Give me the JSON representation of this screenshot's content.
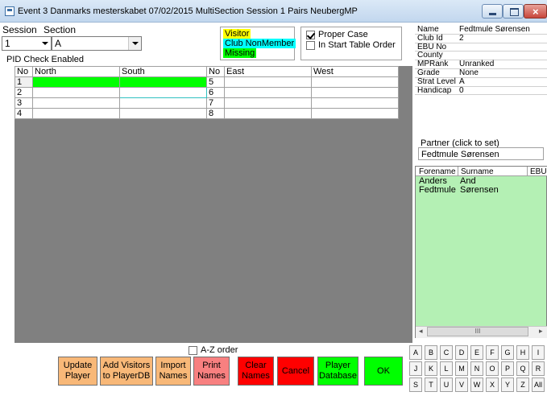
{
  "window": {
    "title": "Event 3   Danmarks mesterskabet 07/02/2015 MultiSection Session 1 Pairs NeubergMP"
  },
  "session": {
    "label": "Session",
    "value": "1"
  },
  "section": {
    "label": "Section",
    "value": "A"
  },
  "pid_status": "PID Check Enabled",
  "legend": {
    "visitor": "Visitor",
    "club_nonmember": "Club NonMember",
    "missing": "Missing"
  },
  "options": {
    "proper_case": "Proper Case",
    "start_table_order": "In Start Table Order"
  },
  "grid": {
    "left_headers": [
      "No",
      "North",
      "South"
    ],
    "right_headers": [
      "No",
      "East",
      "West"
    ],
    "left_numbers": [
      "1",
      "2",
      "3",
      "4"
    ],
    "right_numbers": [
      "5",
      "6",
      "7",
      "8"
    ]
  },
  "info": [
    {
      "key": "Name",
      "value": "Fedtmule Sørensen"
    },
    {
      "key": "Club Id",
      "value": "2"
    },
    {
      "key": "EBU No",
      "value": ""
    },
    {
      "key": "County",
      "value": ""
    },
    {
      "key": "MPRank",
      "value": "Unranked"
    },
    {
      "key": "Grade",
      "value": "None"
    },
    {
      "key": "Strat Level",
      "value": "A"
    },
    {
      "key": "Handicap",
      "value": "0"
    }
  ],
  "partner": {
    "label": "Partner (click to set)",
    "value": "Fedtmule Sørensen"
  },
  "players": {
    "headers": [
      "Forename",
      "Surname",
      "EBU"
    ],
    "rows": [
      {
        "forename": "Anders",
        "surname": "And"
      },
      {
        "forename": "Fedtmule",
        "surname": "Sørensen"
      }
    ],
    "scroll_glyph": "III"
  },
  "az_order": "A-Z order",
  "buttons": {
    "update_player": [
      "Update",
      "Player"
    ],
    "add_visitors": [
      "Add Visitors",
      "to PlayerDB"
    ],
    "import_names": [
      "Import",
      "Names"
    ],
    "print_names": [
      "Print",
      "Names"
    ],
    "clear_names": [
      "Clear",
      "Names"
    ],
    "cancel": "Cancel",
    "player_database": [
      "Player",
      "Database"
    ],
    "ok": "OK"
  },
  "keys": [
    [
      "A",
      "B",
      "C",
      "D",
      "E",
      "F",
      "G",
      "H",
      "I"
    ],
    [
      "J",
      "K",
      "L",
      "M",
      "N",
      "O",
      "P",
      "Q",
      "R"
    ],
    [
      "S",
      "T",
      "U",
      "V",
      "W",
      "X",
      "Y",
      "Z",
      "All"
    ]
  ],
  "colors": {
    "visitor": "#ffff00",
    "club_nonmember": "#00ffff",
    "missing": "#00ff00",
    "orange_button": "#f8b878",
    "pink_button": "#f88080",
    "red_button": "#ff0000",
    "green_button": "#00ff00",
    "grid_background": "#808080",
    "players_background": "#b4f0b4"
  }
}
